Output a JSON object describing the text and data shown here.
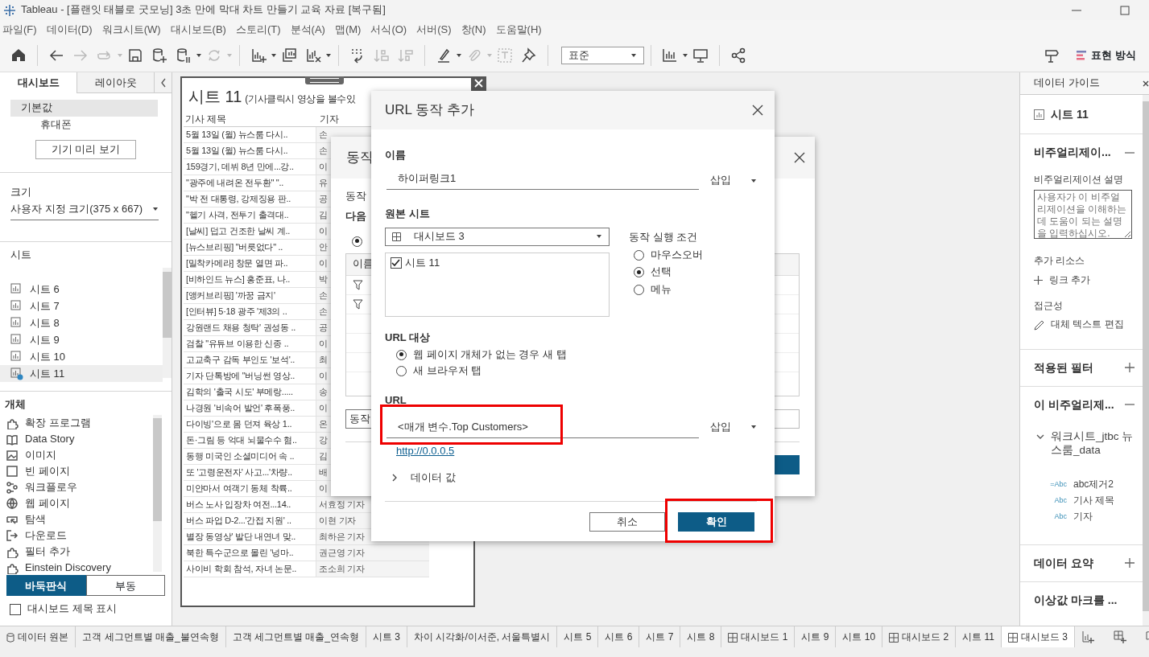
{
  "window": {
    "title": "Tableau - [플랜잇 태블로 굿모닝] 3초 만에 막대 차트 만들기 교육 자료 [복구됨]"
  },
  "menu": [
    "파일(F)",
    "데이터(D)",
    "워크시트(W)",
    "대시보드(B)",
    "스토리(T)",
    "분석(A)",
    "맵(M)",
    "서식(O)",
    "서버(S)",
    "창(N)",
    "도움말(H)"
  ],
  "toolbar": {
    "left_groups": [
      [
        {
          "kind": "home",
          "disabled": false,
          "menu": false
        }
      ],
      [
        {
          "kind": "back",
          "disabled": false,
          "menu": false
        },
        {
          "kind": "forward",
          "disabled": true,
          "menu": false
        },
        {
          "kind": "redo",
          "disabled": true,
          "menu": true
        },
        {
          "kind": "save",
          "disabled": false,
          "menu": false
        },
        {
          "kind": "new-data-source",
          "disabled": false,
          "menu": false
        },
        {
          "kind": "pause-updates",
          "disabled": false,
          "menu": true
        },
        {
          "kind": "refresh",
          "disabled": true,
          "menu": true
        }
      ],
      [
        {
          "kind": "new-sheet",
          "disabled": false,
          "menu": true
        },
        {
          "kind": "duplicate",
          "disabled": false,
          "menu": false
        },
        {
          "kind": "clear-sheet",
          "disabled": false,
          "menu": true
        }
      ],
      [
        {
          "kind": "swap",
          "disabled": false,
          "menu": false
        },
        {
          "kind": "sort-ascending",
          "disabled": true,
          "menu": false
        },
        {
          "kind": "sort-descending",
          "disabled": true,
          "menu": false
        }
      ],
      [
        {
          "kind": "highlight",
          "disabled": false,
          "menu": true
        },
        {
          "kind": "group",
          "disabled": true,
          "menu": true
        },
        {
          "kind": "labels",
          "disabled": true,
          "menu": false
        },
        {
          "kind": "pin",
          "disabled": false,
          "menu": false
        }
      ]
    ],
    "fit": "표준",
    "right_groups": [
      [
        {
          "kind": "show-me",
          "disabled": false,
          "menu": true
        },
        {
          "kind": "presentation",
          "disabled": false,
          "menu": false
        }
      ],
      [
        {
          "kind": "share",
          "disabled": false,
          "menu": false
        }
      ]
    ],
    "show_me_label": "표현 방식"
  },
  "left_panel": {
    "tabs": [
      {
        "label": "대시보드",
        "selected": true
      },
      {
        "label": "레이아웃",
        "selected": false
      }
    ],
    "devices": [
      {
        "label": "기본값",
        "selected": true
      },
      {
        "label": "휴대폰",
        "selected": false
      }
    ],
    "preview_button": "기기 미리 보기",
    "size_label": "크기",
    "size_value": "사용자 지정 크기(375 x 667)",
    "sheets_label": "시트",
    "sheets": [
      {
        "label": "시트 6",
        "selected": false,
        "in_use": false
      },
      {
        "label": "시트 7",
        "selected": false,
        "in_use": false
      },
      {
        "label": "시트 8",
        "selected": false,
        "in_use": false
      },
      {
        "label": "시트 9",
        "selected": false,
        "in_use": false
      },
      {
        "label": "시트 10",
        "selected": false,
        "in_use": false
      },
      {
        "label": "시트 11",
        "selected": true,
        "in_use": true
      }
    ],
    "objects_label": "개체",
    "objects": [
      {
        "kind": "extension",
        "label": "확장 프로그램"
      },
      {
        "kind": "story",
        "label": "Data Story"
      },
      {
        "kind": "image",
        "label": "이미지"
      },
      {
        "kind": "blank",
        "label": "빈 페이지"
      },
      {
        "kind": "workflow",
        "label": "워크플로우"
      },
      {
        "kind": "web",
        "label": "웹 페이지"
      },
      {
        "kind": "navigation",
        "label": "탐색"
      },
      {
        "kind": "download",
        "label": "다운로드"
      },
      {
        "kind": "extension",
        "label": "필터 추가"
      },
      {
        "kind": "extension",
        "label": "Einstein Discovery"
      }
    ],
    "layout_modes": [
      {
        "label": "바둑판식",
        "selected": true
      },
      {
        "label": "부동",
        "selected": false
      }
    ],
    "show_title": {
      "label": "대시보드 제목 표시",
      "checked": false
    }
  },
  "sheet": {
    "title": "시트 11",
    "subtitle": "(기사클릭시 영상을 볼수있",
    "columns": [
      "기사 제목",
      "기자"
    ],
    "rows": [
      {
        "title": "5월 13일 (월) 뉴스룸 다시..",
        "reporter": "손"
      },
      {
        "title": "5월 13일 (월) 뉴스룸 다시..",
        "reporter": "손"
      },
      {
        "title": "159경기, 데뷔 8년 만에...강..",
        "reporter": "이"
      },
      {
        "title": "\"광주에 내려온 전두환\" \"..",
        "reporter": "유"
      },
      {
        "title": "\"박 전 대통령, 강제징용 판..",
        "reporter": "공"
      },
      {
        "title": "\"헬기 사격, 전투기 출격대..",
        "reporter": "김"
      },
      {
        "title": "[날씨] 덥고 건조한 날씨 계..",
        "reporter": "이"
      },
      {
        "title": "[뉴스브리핑] \"버릇없다\" ..",
        "reporter": "안"
      },
      {
        "title": "[밀착카메라] 창문 열면 파..",
        "reporter": "이"
      },
      {
        "title": "[비하인드 뉴스] 홍준표, 나..",
        "reporter": "박"
      },
      {
        "title": "[앵커브리핑] '까꿍 금지'",
        "reporter": "손"
      },
      {
        "title": "[인터뷰] 5·18 광주 '제3의 ..",
        "reporter": "손"
      },
      {
        "title": "강원랜드 채용 청탁' 권성동 ..",
        "reporter": "공"
      },
      {
        "title": "검찰 \"유튜브 이용한 신종 ..",
        "reporter": "이"
      },
      {
        "title": "고교축구 감독 부인도 '보석'..",
        "reporter": "최"
      },
      {
        "title": "기자 단톡방에 \"버닝썬 영상..",
        "reporter": "이"
      },
      {
        "title": "김학의 '출국 시도' 부메랑.....",
        "reporter": "송"
      },
      {
        "title": "나경원 '비속어 발언' 후폭풍..",
        "reporter": "이"
      },
      {
        "title": "다이빙'으로 몸 던져 육상 1..",
        "reporter": "온"
      },
      {
        "title": "돈·그림 등 억대 뇌물수수 혐..",
        "reporter": "강"
      },
      {
        "title": "동행 미국인 소셜미디어 속 ..",
        "reporter": "김"
      },
      {
        "title": "또 '고령운전자' 사고...'차량..",
        "reporter": "배"
      },
      {
        "title": "미얀마서 여객기 동체 착륙..",
        "reporter": "이"
      },
      {
        "title": "버스 노사 입장차 여전...14..",
        "reporter": "서효정 기자"
      },
      {
        "title": "버스 파업 D-2...'간접 지원' ..",
        "reporter": "이현 기자"
      },
      {
        "title": "별장 동영상' 발단 내연녀 맞..",
        "reporter": "최하은 기자"
      },
      {
        "title": "북한 특수군으로 몰린 '넝마..",
        "reporter": "권근영 기자"
      },
      {
        "title": "사이비 학회 참석, 자녀 논문..",
        "reporter": "조소희 기자"
      }
    ]
  },
  "actions_dialog": {
    "title": "동작",
    "intro": "동작",
    "run_label": "다음",
    "radio_selected": true,
    "column": "이름",
    "rows": [
      {
        "filter": true
      },
      {
        "filter": true
      },
      {
        "filter": false
      },
      {
        "filter": false
      },
      {
        "filter": false
      }
    ],
    "add_button": "동작"
  },
  "url_dialog": {
    "title": "URL 동작 추가",
    "name_label": "이름",
    "name_value": "하이퍼링크1",
    "name_insert": "삽입",
    "source_label": "원본 시트",
    "source_value": "대시보드 3",
    "source_sheets": [
      {
        "label": "시트 11",
        "checked": true
      }
    ],
    "run_on_label": "동작 실행 조건",
    "run_on": [
      {
        "label": "마우스오버",
        "selected": false
      },
      {
        "label": "선택",
        "selected": true
      },
      {
        "label": "메뉴",
        "selected": false
      }
    ],
    "target_label": "URL 대상",
    "targets": [
      {
        "label": "웹 페이지 개체가 없는 경우 새 탭",
        "selected": true
      },
      {
        "label": "새 브라우저 탭",
        "selected": false
      }
    ],
    "url_label": "URL",
    "url_value": "<매개 변수.Top Customers>",
    "url_insert": "삽입",
    "url_highlighted": true,
    "url_preview": "http://0.0.0.5",
    "data_values": {
      "label": "데이터 값",
      "expanded": false
    },
    "cancel": "취소",
    "ok": "확인",
    "ok_highlighted": true
  },
  "data_guide": {
    "title": "데이터 가이드",
    "sheet": "시트 11",
    "viz_section": {
      "title": "비주얼리제이...",
      "expanded": true
    },
    "description_label": "비주얼리제이션 설명",
    "description_placeholder": "사용자가 이 비주얼리제이션을 이해하는 데 도움이 되는 설명을 입력하십시오.",
    "resources_label": "추가 리소스",
    "add_link": "링크 추가",
    "accessibility_label": "접근성",
    "alt_text": "대체 텍스트 편집",
    "filters_section": {
      "title": "적용된 필터",
      "expanded": false
    },
    "fields_section": {
      "title": "이 비주얼리제...",
      "expanded": true
    },
    "datasource": {
      "label": "워크시트_jtbc 뉴스룸_data",
      "expanded": true,
      "fields": [
        {
          "type": "=Abc",
          "label": "abc제거2"
        },
        {
          "type": "Abc",
          "label": "기사 제목"
        },
        {
          "type": "Abc",
          "label": "기자"
        }
      ]
    },
    "summary_section": {
      "title": "데이터 요약",
      "expanded": false
    },
    "outliers_section": {
      "title": "이상값 마크를 ..."
    }
  },
  "bottom_tabs": [
    {
      "kind": "datasource",
      "label": "데이터 원본",
      "selected": false
    },
    {
      "kind": "sheet",
      "label": "고객 세그먼트별 매출_불연속형",
      "selected": false
    },
    {
      "kind": "sheet",
      "label": "고객 세그먼트별 매출_연속형",
      "selected": false
    },
    {
      "kind": "sheet",
      "label": "시트 3",
      "selected": false
    },
    {
      "kind": "sheet",
      "label": "차이 시각화/이서준, 서울특별시",
      "selected": false
    },
    {
      "kind": "sheet",
      "label": "시트 5",
      "selected": false
    },
    {
      "kind": "sheet",
      "label": "시트 6",
      "selected": false
    },
    {
      "kind": "sheet",
      "label": "시트 7",
      "selected": false
    },
    {
      "kind": "sheet",
      "label": "시트 8",
      "selected": false
    },
    {
      "kind": "dashboard",
      "label": "대시보드 1",
      "selected": false
    },
    {
      "kind": "sheet",
      "label": "시트 9",
      "selected": false
    },
    {
      "kind": "sheet",
      "label": "시트 10",
      "selected": false
    },
    {
      "kind": "dashboard",
      "label": "대시보드 2",
      "selected": false
    },
    {
      "kind": "sheet",
      "label": "시트 11",
      "selected": false
    },
    {
      "kind": "dashboard",
      "label": "대시보드 3",
      "selected": true
    }
  ]
}
